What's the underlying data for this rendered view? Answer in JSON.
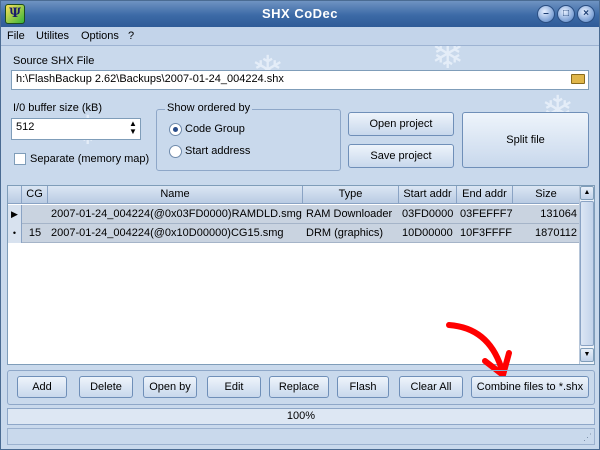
{
  "window": {
    "title": "SHX CoDec"
  },
  "menu": {
    "items": [
      "File",
      "Utilites",
      "Options",
      "?"
    ]
  },
  "source": {
    "label": "Source SHX File",
    "path": "h:\\FlashBackup 2.62\\Backups\\2007-01-24_004224.shx"
  },
  "buffer": {
    "label": "I/0 buffer size (kB)",
    "value": "512"
  },
  "separate": {
    "label": "Separate (memory map)",
    "checked": false
  },
  "order": {
    "caption": "Show ordered by",
    "options": [
      "Code Group",
      "Start address"
    ],
    "selected": "Code Group"
  },
  "buttons": {
    "open_project": "Open project",
    "save_project": "Save project",
    "split_file": "Split file"
  },
  "table": {
    "columns": [
      "CG",
      "Name",
      "Type",
      "Start addr",
      "End addr",
      "Size"
    ],
    "rows": [
      {
        "marker": "▶",
        "cg": "",
        "name": "2007-01-24_004224(@0x03FD0000)RAMDLD.smg",
        "type": "RAM Downloader",
        "start": "03FD0000",
        "end": "03FEFFF7",
        "size": "131064"
      },
      {
        "marker": "•",
        "cg": "15",
        "name": "2007-01-24_004224(@0x10D00000)CG15.smg",
        "type": "DRM (graphics)",
        "start": "10D00000",
        "end": "10F3FFFF",
        "size": "1870112"
      }
    ]
  },
  "toolbar": {
    "add": "Add",
    "delete": "Delete",
    "open_by": "Open by",
    "edit": "Edit",
    "replace": "Replace",
    "flash": "Flash",
    "clear_all": "Clear All",
    "combine": "Combine files to *.shx"
  },
  "progress": {
    "text": "100%",
    "value": 100
  },
  "colors": {
    "title_bar": "#3c6aa6",
    "window_bg": "#c9d9ec",
    "arrow": "#ff0000"
  }
}
